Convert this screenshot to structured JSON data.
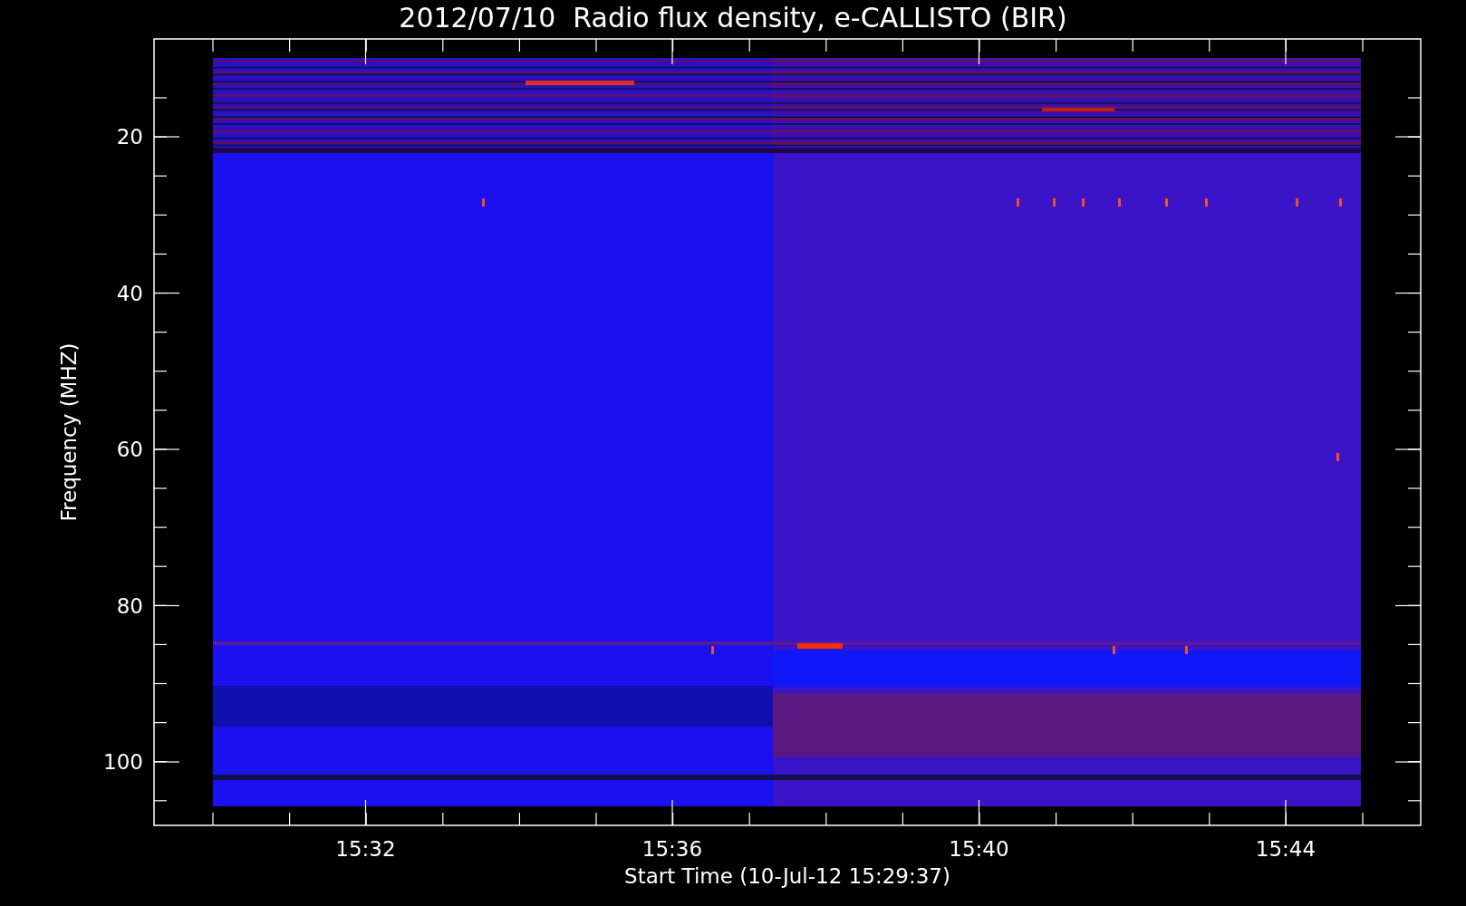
{
  "title": "2012/07/10  Radio flux density, e-CALLISTO (BIR)",
  "y_axis": {
    "label": "Frequency (MHZ)",
    "ticks": [
      "20",
      "40",
      "60",
      "80",
      "100"
    ]
  },
  "x_axis": {
    "label": "Start Time (10-Jul-12 15:29:37)",
    "ticks": [
      "15:32",
      "15:36",
      "15:40",
      "15:44"
    ]
  }
}
